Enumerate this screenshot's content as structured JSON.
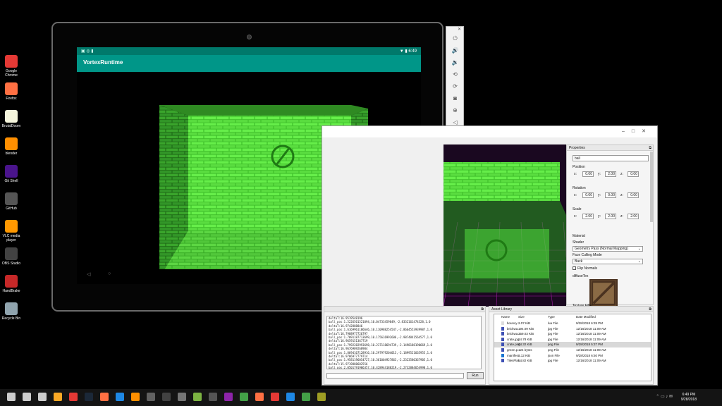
{
  "desktop": {
    "icons": [
      {
        "label": "Google\nChrome",
        "name": "chrome-icon",
        "color": "#e53935"
      },
      {
        "label": "Firefox",
        "name": "firefox-icon",
        "color": "#ff7043"
      },
      {
        "label": "BrutalDoom",
        "name": "file-icon",
        "color": "#f5f5dc"
      },
      {
        "label": "blender",
        "name": "blender-icon",
        "color": "#ff8f00"
      },
      {
        "label": "Git Shell",
        "name": "terminal-icon",
        "color": "#4a148c"
      },
      {
        "label": "GitHub",
        "name": "github-icon",
        "color": "#555555"
      },
      {
        "label": "VLC media\nplayer",
        "name": "vlc-icon",
        "color": "#ff9800"
      },
      {
        "label": "OBS Studio",
        "name": "obs-icon",
        "color": "#424242"
      },
      {
        "label": "HandBrake",
        "name": "handbrake-icon",
        "color": "#c62828"
      },
      {
        "label": "Recycle Bin",
        "name": "recycle-bin-icon",
        "color": "#90a4ae"
      }
    ]
  },
  "tablet": {
    "status_time": "6:49",
    "app_title": "VortexRuntime",
    "nav_back": "◁",
    "nav_home": "○"
  },
  "emulator_toolbar": {
    "close": "✕",
    "buttons": [
      {
        "name": "power-icon",
        "glyph": "⏻"
      },
      {
        "name": "volume-up-icon",
        "glyph": "🔊"
      },
      {
        "name": "volume-down-icon",
        "glyph": "🔉"
      },
      {
        "name": "rotate-left-icon",
        "glyph": "⟲"
      },
      {
        "name": "rotate-right-icon",
        "glyph": "⟳"
      },
      {
        "name": "camera-icon",
        "glyph": "◙"
      },
      {
        "name": "zoom-icon",
        "glyph": "⊕"
      },
      {
        "name": "back-icon",
        "glyph": "◁"
      },
      {
        "name": "home-icon",
        "glyph": "○"
      },
      {
        "name": "overview-icon",
        "glyph": "□"
      },
      {
        "name": "more-icon",
        "glyph": "⋯"
      }
    ]
  },
  "editor": {
    "window_controls": "–□✕",
    "properties": {
      "title": "Properties",
      "name_value": "ball",
      "position_label": "Position",
      "rotation_label": "Rotation",
      "scale_label": "Scale",
      "x_label": "x:",
      "y_label": "y:",
      "z_label": "z:",
      "position": [
        "0.00",
        "2.00",
        "0.00"
      ],
      "rotation": [
        "0.00",
        "0.00",
        "0.00"
      ],
      "scale": [
        "2.00",
        "2.00",
        "2.00"
      ],
      "material_label": "Material",
      "shader_label": "Shader",
      "shader_value": "Geometry Pass (Normal Mapping)",
      "face_culling_label": "Face Culling Mode",
      "face_culling_value": "Back",
      "flip_normals_label": "Flip Normals",
      "diffuse_label": "diffuseTex",
      "texture_filter_label": "Texture Filter"
    },
    "console": {
      "lines": [
        "deltaT:16.9519548196",
        "ball_pos:1.5226561521094,10.04733459849,-2.8332161474328,1.0",
        "deltaT:16.9742888846",
        "ball_pos:1.6169961186646,10.110988254547,-2.8664553939987,1.0",
        "deltaT:16.7988977726797",
        "ball_pos:1.7091187713699,10.175616992606,-2.9874841564577,1.0",
        "deltaT:16.9659151367719",
        "ball_pos:1.7992282993698,10.237118694739,-2.1498188190669,1.0",
        "deltaT:16.9676909268904",
        "ball_pos:1.8694167128916,10.297979204013,-2.1899521665955,1.0",
        "deltaT:16.9786977779714",
        "ball_pos:1.9581196054727,10.361004927863,-2.2323580367905,1.0",
        "deltaT:15.9719888682556",
        "ball_pos:2.0501791906357,10.428944188219,-2.2732884654998,1.0"
      ],
      "run_label": "Run"
    },
    "assets": {
      "title": "Asset Library",
      "headers": [
        "Name",
        "Size",
        "Type",
        "Date Modified"
      ],
      "rows": [
        {
          "name": "bouncy....",
          "size": "2.07 KiB",
          "type": "lua File",
          "date": "9/28/2018 6:39 PM",
          "icon_color": "#dddddd"
        },
        {
          "name": "brickwa...",
          "size": "194.09 KiB",
          "type": "jpg File",
          "date": "12/16/2018 11:09 AM",
          "icon_color": "#3f51b5"
        },
        {
          "name": "brickwa...",
          "size": "359.03 KiB",
          "type": "jpg File",
          "date": "12/16/2018 11:09 AM",
          "icon_color": "#3f51b5"
        },
        {
          "name": "crate.jpg",
          "size": "14.78 KiB",
          "type": "jpg File",
          "date": "12/16/2018 11:09 AM",
          "icon_color": "#3f51b5"
        },
        {
          "name": "crate.png",
          "size": "64.32 KiB",
          "type": "png File",
          "date": "9/28/2018 5:37 PM",
          "icon_color": "#3f51b5"
        },
        {
          "name": "green.p...",
          "size": "124 bytes",
          "type": "png File",
          "date": "12/16/2018 11:09 AM",
          "icon_color": "#3f51b5"
        },
        {
          "name": "manifes...",
          "size": "8.12 KiB",
          "type": "json File",
          "date": "9/28/2018 6:50 PM",
          "icon_color": "#1976d2"
        },
        {
          "name": "TilesPlai...",
          "size": "54.82 KiB",
          "type": "jpg File",
          "date": "12/16/2018 11:09 AM",
          "icon_color": "#3f51b5"
        }
      ],
      "selected_index": 4
    }
  },
  "taskbar": {
    "time": "6:49 PM",
    "date": "9/28/2018",
    "items": [
      {
        "name": "start-icon",
        "color": "#cccccc"
      },
      {
        "name": "search-icon",
        "color": "#cccccc"
      },
      {
        "name": "task-view-icon",
        "color": "#cccccc"
      },
      {
        "name": "explorer-icon",
        "color": "#f9a825"
      },
      {
        "name": "chrome-taskbar-icon",
        "color": "#e53935"
      },
      {
        "name": "steam-icon",
        "color": "#1b2838"
      },
      {
        "name": "firefox-taskbar-icon",
        "color": "#ff7043"
      },
      {
        "name": "vscode-icon",
        "color": "#1e88e5"
      },
      {
        "name": "blender-taskbar-icon",
        "color": "#ff8f00"
      },
      {
        "name": "obs-taskbar-icon",
        "color": "#616161"
      },
      {
        "name": "terminal-taskbar-icon",
        "color": "#424242"
      },
      {
        "name": "calculator-icon",
        "color": "#757575"
      },
      {
        "name": "android-icon",
        "color": "#7cb342"
      },
      {
        "name": "github-taskbar-icon",
        "color": "#555555"
      },
      {
        "name": "app-icon",
        "color": "#8e24aa"
      },
      {
        "name": "app2-icon",
        "color": "#43a047"
      },
      {
        "name": "firefox2-icon",
        "color": "#ff7043"
      },
      {
        "name": "app3-icon",
        "color": "#e53935"
      },
      {
        "name": "app4-icon",
        "color": "#1e88e5"
      },
      {
        "name": "android2-icon",
        "color": "#43a047"
      },
      {
        "name": "vortex-icon",
        "color": "#9e9d24"
      }
    ],
    "tray": "⌃ ▭ ♪ ✉"
  }
}
